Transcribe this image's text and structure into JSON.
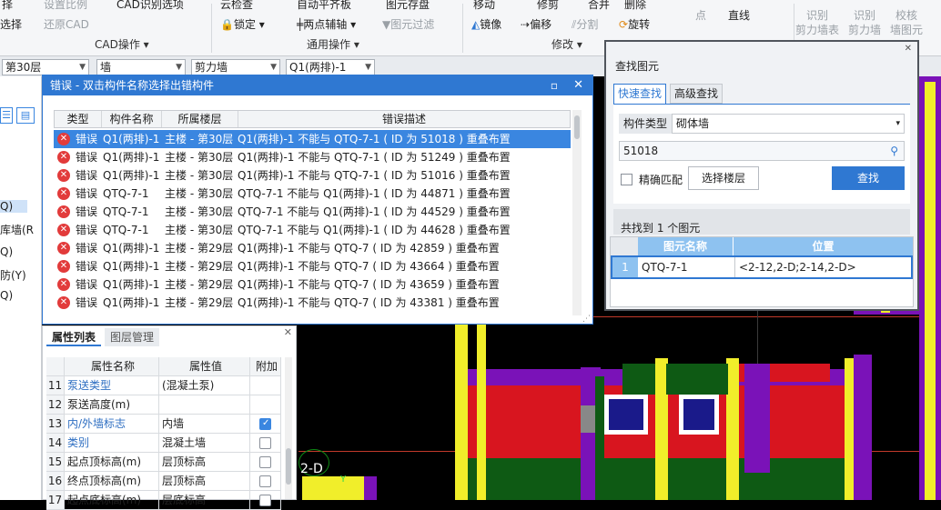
{
  "ribbon": {
    "row1": [
      "择",
      "设置比例",
      "CAD识别选项",
      "云检查",
      "自动平齐板",
      "图元存盘",
      "移动",
      "修剪",
      "合并",
      "删除",
      "点",
      "直线",
      "识别",
      "识别",
      "校核"
    ],
    "row2": [
      "选择",
      "还原CAD",
      "锁定",
      "两点辅轴",
      "图元过滤",
      "镜像",
      "偏移",
      "分割",
      "旋转",
      "剪力墙表",
      "剪力墙",
      "墙图元"
    ],
    "groups": [
      "CAD操作",
      "通用操作",
      "修改"
    ]
  },
  "toolbar": {
    "floor": "第30层",
    "type": "墙",
    "subtype": "剪力墙",
    "component": "Q1(两排)-1"
  },
  "left_panel": {
    "items": [
      "Q)",
      "库墙(R",
      "Q)",
      "防(Y)",
      "Q)"
    ]
  },
  "error_dialog": {
    "title": "错误 - 双击构件名称选择出错构件",
    "headers": [
      "类型",
      "构件名称",
      "所属楼层",
      "错误描述"
    ],
    "rows": [
      {
        "type": "错误",
        "name": "Q1(两排)-1",
        "floor": "主楼 - 第30层",
        "desc": "Q1(两排)-1 不能与 QTQ-7-1 ( ID 为 51018 ) 重叠布置"
      },
      {
        "type": "错误",
        "name": "Q1(两排)-1",
        "floor": "主楼 - 第30层",
        "desc": "Q1(两排)-1 不能与 QTQ-7-1 ( ID 为 51249 ) 重叠布置"
      },
      {
        "type": "错误",
        "name": "Q1(两排)-1",
        "floor": "主楼 - 第30层",
        "desc": "Q1(两排)-1 不能与 QTQ-7-1 ( ID 为 51016 ) 重叠布置"
      },
      {
        "type": "错误",
        "name": "QTQ-7-1",
        "floor": "主楼 - 第30层",
        "desc": "QTQ-7-1 不能与 Q1(两排)-1 ( ID 为 44871 ) 重叠布置"
      },
      {
        "type": "错误",
        "name": "QTQ-7-1",
        "floor": "主楼 - 第30层",
        "desc": "QTQ-7-1 不能与 Q1(两排)-1 ( ID 为 44529 ) 重叠布置"
      },
      {
        "type": "错误",
        "name": "QTQ-7-1",
        "floor": "主楼 - 第30层",
        "desc": "QTQ-7-1 不能与 Q1(两排)-1 ( ID 为 44628 ) 重叠布置"
      },
      {
        "type": "错误",
        "name": "Q1(两排)-1",
        "floor": "主楼 - 第29层",
        "desc": "Q1(两排)-1 不能与 QTQ-7 ( ID 为 42859 ) 重叠布置"
      },
      {
        "type": "错误",
        "name": "Q1(两排)-1",
        "floor": "主楼 - 第29层",
        "desc": "Q1(两排)-1 不能与 QTQ-7 ( ID 为 43664 ) 重叠布置"
      },
      {
        "type": "错误",
        "name": "Q1(两排)-1",
        "floor": "主楼 - 第29层",
        "desc": "Q1(两排)-1 不能与 QTQ-7 ( ID 为 43659 ) 重叠布置"
      },
      {
        "type": "错误",
        "name": "Q1(两排)-1",
        "floor": "主楼 - 第29层",
        "desc": "Q1(两排)-1 不能与 QTQ-7 ( ID 为 43381 ) 重叠布置"
      }
    ]
  },
  "properties": {
    "tabs": [
      "属性列表",
      "图层管理"
    ],
    "headers": [
      "属性名称",
      "属性值",
      "附加"
    ],
    "rows": [
      {
        "num": "11",
        "name": "泵送类型",
        "value": "(混凝土泵)",
        "checked": null,
        "blue": true
      },
      {
        "num": "12",
        "name": "泵送高度(m)",
        "value": "",
        "checked": null,
        "blue": false
      },
      {
        "num": "13",
        "name": "内/外墙标志",
        "value": "内墙",
        "checked": true,
        "blue": true
      },
      {
        "num": "14",
        "name": "类别",
        "value": "混凝土墙",
        "checked": false,
        "blue": true
      },
      {
        "num": "15",
        "name": "起点顶标高(m)",
        "value": "层顶标高",
        "checked": false,
        "blue": false
      },
      {
        "num": "16",
        "name": "终点顶标高(m)",
        "value": "层顶标高",
        "checked": false,
        "blue": false
      },
      {
        "num": "17",
        "name": "起点底标高(m)",
        "value": "层底标高",
        "checked": false,
        "blue": false
      }
    ]
  },
  "find_dialog": {
    "title": "查找图元",
    "tabs": [
      "快速查找",
      "高级查找"
    ],
    "type_label": "构件类型",
    "type_value": "砌体墙",
    "search_value": "51018",
    "exact_label": "精确匹配",
    "floor_button": "选择楼层",
    "find_button": "查找",
    "result_text": "共找到 1 个图元",
    "result_headers": [
      "图元名称",
      "位置"
    ],
    "results": [
      {
        "num": "1",
        "name": "QTQ-7-1",
        "position": "<2-12,2-D;2-14,2-D>"
      }
    ]
  },
  "canvas": {
    "axis_label": "2-D"
  },
  "colors": {
    "accent": "#2f78d2",
    "error": "#e23b3b",
    "wall_red": "#d8151f",
    "wall_purple": "#7a12b8",
    "wall_yellow": "#f1ee2a",
    "wall_green": "#0e5a14"
  }
}
